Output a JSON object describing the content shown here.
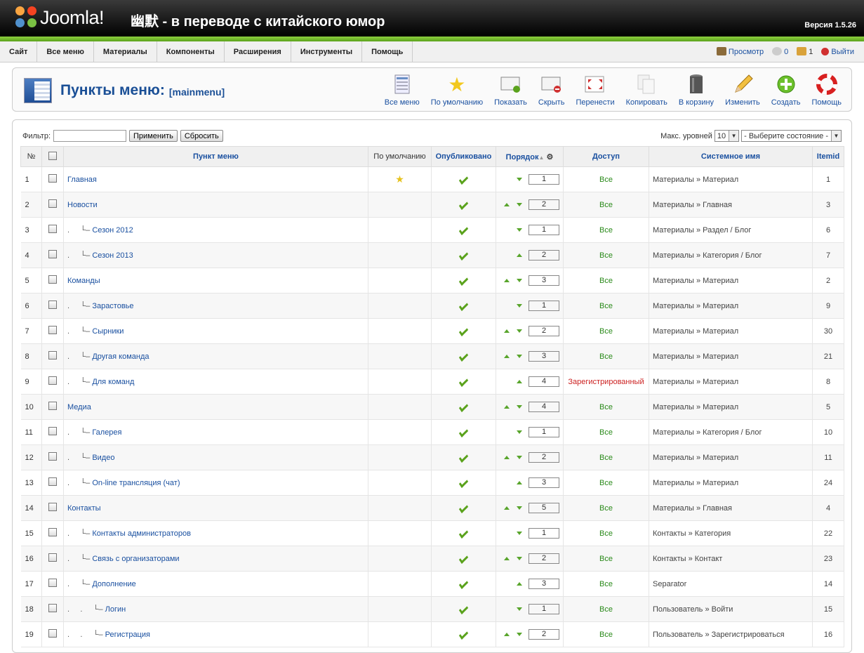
{
  "header": {
    "logo_text": "Joomla!",
    "site_title": "幽默 - в переводе с китайского юмор",
    "version": "Версия 1.5.26"
  },
  "menubar": {
    "items": [
      "Сайт",
      "Все меню",
      "Материалы",
      "Компоненты",
      "Расширения",
      "Инструменты",
      "Помощь"
    ],
    "status": {
      "preview": "Просмотр",
      "messages": "0",
      "users": "1",
      "logout": "Выйти"
    }
  },
  "page": {
    "title": "Пункты меню:",
    "subtitle": "[mainmenu]"
  },
  "toolbar": [
    {
      "label": "Все меню",
      "icon": "menus-icon"
    },
    {
      "label": "По умолчанию",
      "icon": "default-star-icon"
    },
    {
      "label": "Показать",
      "icon": "publish-icon"
    },
    {
      "label": "Скрыть",
      "icon": "unpublish-icon"
    },
    {
      "label": "Перенести",
      "icon": "move-icon"
    },
    {
      "label": "Копировать",
      "icon": "copy-icon"
    },
    {
      "label": "В корзину",
      "icon": "trash-icon"
    },
    {
      "label": "Изменить",
      "icon": "edit-icon"
    },
    {
      "label": "Создать",
      "icon": "new-icon"
    },
    {
      "label": "Помощь",
      "icon": "help-icon"
    }
  ],
  "filter": {
    "label": "Фильтр:",
    "value": "",
    "apply": "Применить",
    "reset": "Сбросить",
    "levels_label": "Макс. уровней",
    "levels_value": "10",
    "state_value": "- Выберите состояние -"
  },
  "columns": {
    "num": "№",
    "item": "Пункт меню",
    "default": "По умолчанию",
    "published": "Опубликовано",
    "order": "Порядок",
    "access": "Доступ",
    "sysname": "Системное имя",
    "itemid": "Itemid"
  },
  "rows": [
    {
      "n": "1",
      "prefix": "",
      "name": "Главная",
      "def": true,
      "up": false,
      "dn": true,
      "order": "1",
      "access": "Все",
      "sys": "Материалы » Материал",
      "id": "1"
    },
    {
      "n": "2",
      "prefix": "",
      "name": "Новости",
      "def": false,
      "up": true,
      "dn": true,
      "order": "2",
      "access": "Все",
      "sys": "Материалы » Главная",
      "id": "3"
    },
    {
      "n": "3",
      "prefix": ".     └– ",
      "name": "Сезон 2012",
      "def": false,
      "up": false,
      "dn": true,
      "order": "1",
      "access": "Все",
      "sys": "Материалы » Раздел / Блог",
      "id": "6"
    },
    {
      "n": "4",
      "prefix": ".     └– ",
      "name": "Сезон 2013",
      "def": false,
      "up": true,
      "dn": false,
      "order": "2",
      "access": "Все",
      "sys": "Материалы » Категория / Блог",
      "id": "7"
    },
    {
      "n": "5",
      "prefix": "",
      "name": "Команды",
      "def": false,
      "up": true,
      "dn": true,
      "order": "3",
      "access": "Все",
      "sys": "Материалы » Материал",
      "id": "2"
    },
    {
      "n": "6",
      "prefix": ".     └– ",
      "name": "Зарастовье",
      "def": false,
      "up": false,
      "dn": true,
      "order": "1",
      "access": "Все",
      "sys": "Материалы » Материал",
      "id": "9"
    },
    {
      "n": "7",
      "prefix": ".     └– ",
      "name": "Сырники",
      "def": false,
      "up": true,
      "dn": true,
      "order": "2",
      "access": "Все",
      "sys": "Материалы » Материал",
      "id": "30"
    },
    {
      "n": "8",
      "prefix": ".     └– ",
      "name": "Другая команда",
      "def": false,
      "up": true,
      "dn": true,
      "order": "3",
      "access": "Все",
      "sys": "Материалы » Материал",
      "id": "21"
    },
    {
      "n": "9",
      "prefix": ".     └– ",
      "name": "Для команд",
      "def": false,
      "up": true,
      "dn": false,
      "order": "4",
      "access": "Зарегистрированный",
      "sys": "Материалы » Материал",
      "id": "8"
    },
    {
      "n": "10",
      "prefix": "",
      "name": "Медиа",
      "def": false,
      "up": true,
      "dn": true,
      "order": "4",
      "access": "Все",
      "sys": "Материалы » Материал",
      "id": "5"
    },
    {
      "n": "11",
      "prefix": ".     └– ",
      "name": "Галерея",
      "def": false,
      "up": false,
      "dn": true,
      "order": "1",
      "access": "Все",
      "sys": "Материалы » Категория / Блог",
      "id": "10"
    },
    {
      "n": "12",
      "prefix": ".     └– ",
      "name": "Видео",
      "def": false,
      "up": true,
      "dn": true,
      "order": "2",
      "access": "Все",
      "sys": "Материалы » Материал",
      "id": "11"
    },
    {
      "n": "13",
      "prefix": ".     └– ",
      "name": "On-line трансляция (чат)",
      "def": false,
      "up": true,
      "dn": false,
      "order": "3",
      "access": "Все",
      "sys": "Материалы » Материал",
      "id": "24"
    },
    {
      "n": "14",
      "prefix": "",
      "name": "Контакты",
      "def": false,
      "up": true,
      "dn": true,
      "order": "5",
      "access": "Все",
      "sys": "Материалы » Главная",
      "id": "4"
    },
    {
      "n": "15",
      "prefix": ".     └– ",
      "name": "Контакты администраторов",
      "def": false,
      "up": false,
      "dn": true,
      "order": "1",
      "access": "Все",
      "sys": "Контакты » Категория",
      "id": "22"
    },
    {
      "n": "16",
      "prefix": ".     └– ",
      "name": "Связь с организаторами",
      "def": false,
      "up": true,
      "dn": true,
      "order": "2",
      "access": "Все",
      "sys": "Контакты » Контакт",
      "id": "23"
    },
    {
      "n": "17",
      "prefix": ".     └– ",
      "name": "Дополнение",
      "def": false,
      "up": true,
      "dn": false,
      "order": "3",
      "access": "Все",
      "sys": "Separator",
      "id": "14"
    },
    {
      "n": "18",
      "prefix": ".     .     └– ",
      "name": "Логин",
      "def": false,
      "up": false,
      "dn": true,
      "order": "1",
      "access": "Все",
      "sys": "Пользователь » Войти",
      "id": "15"
    },
    {
      "n": "19",
      "prefix": ".     .     └– ",
      "name": "Регистрация",
      "def": false,
      "up": true,
      "dn": true,
      "order": "2",
      "access": "Все",
      "sys": "Пользователь » Зарегистрироваться",
      "id": "16"
    }
  ]
}
